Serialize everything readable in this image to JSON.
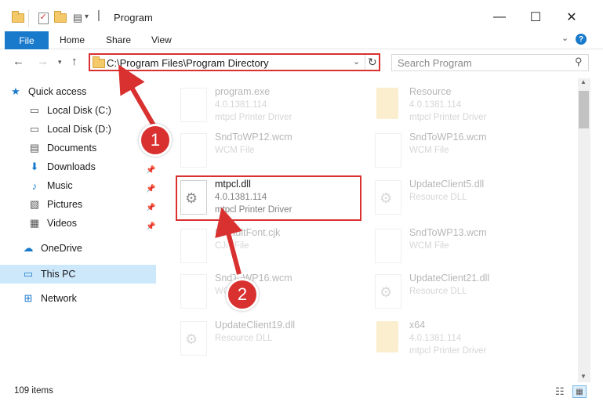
{
  "window": {
    "title": "Program"
  },
  "ribbon": {
    "file": "File",
    "home": "Home",
    "share": "Share",
    "view": "View",
    "help": "?"
  },
  "address": {
    "path": "C:\\Program Files\\Program Directory"
  },
  "search": {
    "placeholder": "Search Program"
  },
  "sidebar": {
    "items": [
      {
        "label": "Quick access",
        "icon": "star-icon"
      },
      {
        "label": "Local Disk (C:)",
        "icon": "drive-icon"
      },
      {
        "label": "Local Disk (D:)",
        "icon": "drive-icon"
      },
      {
        "label": "Documents",
        "icon": "documents-icon"
      },
      {
        "label": "Downloads",
        "icon": "download-icon"
      },
      {
        "label": "Music",
        "icon": "music-icon"
      },
      {
        "label": "Pictures",
        "icon": "pictures-icon"
      },
      {
        "label": "Videos",
        "icon": "videos-icon"
      },
      {
        "label": "OneDrive",
        "icon": "cloud-icon"
      },
      {
        "label": "This PC",
        "icon": "computer-icon"
      },
      {
        "label": "Network",
        "icon": "network-icon"
      }
    ]
  },
  "files": [
    {
      "name": "program.exe",
      "line1": "4.0.1381.114",
      "line2": "mtpcl Printer Driver",
      "icon": "exe-icon"
    },
    {
      "name": "Resource",
      "line1": "4.0.1381.114",
      "line2": "mtpcl Printer Driver",
      "icon": "folder-icon"
    },
    {
      "name": "SndToWP12.wcm",
      "line1": "WCM File",
      "line2": "",
      "icon": "file-icon"
    },
    {
      "name": "SndToWP16.wcm",
      "line1": "WCM File",
      "line2": "",
      "icon": "file-icon"
    },
    {
      "name": "mtpcl.dll",
      "line1": "4.0.1381.114",
      "line2": "mtpcl Printer Driver",
      "icon": "dll-gear-icon"
    },
    {
      "name": "UpdateClient5.dll",
      "line1": "Resource DLL",
      "line2": "",
      "icon": "dll-gear-icon"
    },
    {
      "name": "DefaultFont.cjk",
      "line1": "CJK File",
      "line2": "",
      "icon": "file-icon"
    },
    {
      "name": "SndToWP13.wcm",
      "line1": "WCM File",
      "line2": "",
      "icon": "file-icon"
    },
    {
      "name": "SndToWP16.wcm",
      "line1": "WCM File",
      "line2": "",
      "icon": "file-icon"
    },
    {
      "name": "UpdateClient21.dll",
      "line1": "Resource DLL",
      "line2": "",
      "icon": "dll-gear-icon"
    },
    {
      "name": "UpdateClient19.dll",
      "line1": "Resource DLL",
      "line2": "",
      "icon": "dll-gear-icon"
    },
    {
      "name": "x64",
      "line1": "4.0.1381.114",
      "line2": "mtpcl Printer Driver",
      "icon": "folder-icon"
    }
  ],
  "callouts": {
    "step1": "1",
    "step2": "2"
  },
  "status": {
    "count": "109 items"
  },
  "colors": {
    "accent": "#1979ca",
    "highlight": "#d93030",
    "selection": "#cde8fb"
  }
}
